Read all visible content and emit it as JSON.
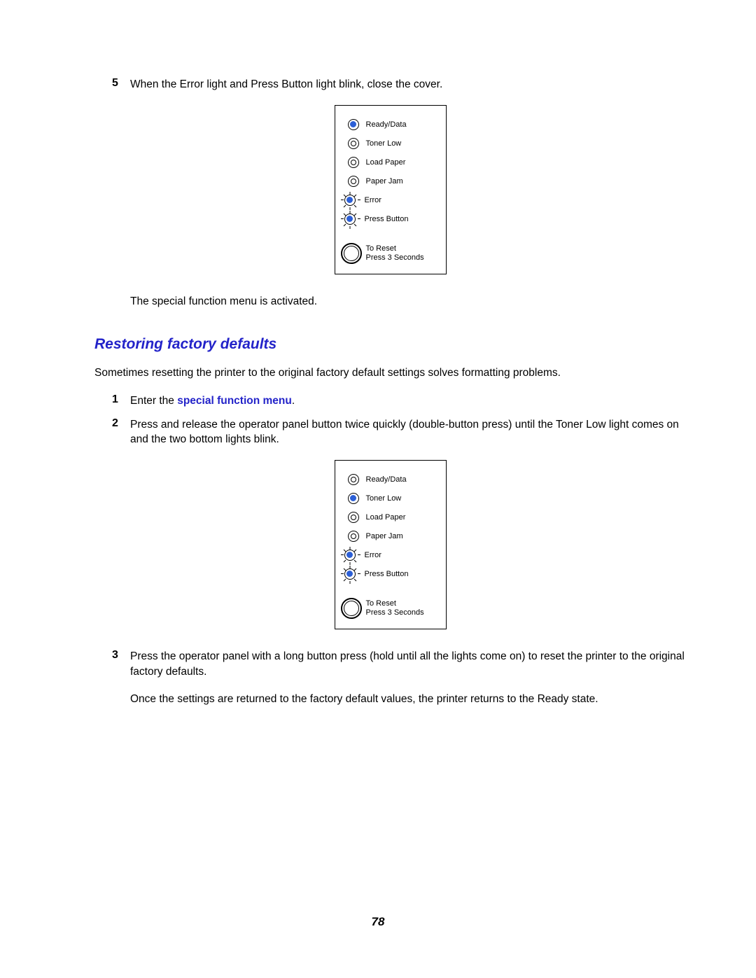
{
  "page_number": "78",
  "step5": {
    "num": "5",
    "text": "When the Error light and Press Button light blink, close the cover."
  },
  "step5_followup": "The special function menu is activated.",
  "section_heading": "Restoring factory defaults",
  "section_intro": "Sometimes resetting the printer to the original factory default settings solves formatting problems.",
  "step1": {
    "num": "1",
    "prefix": "Enter the ",
    "link": "special function menu",
    "suffix": "."
  },
  "step2": {
    "num": "2",
    "text": "Press and release the operator panel button twice quickly (double-button press) until the Toner Low light comes on and the two bottom lights blink."
  },
  "step3": {
    "num": "3",
    "text": "Press the operator panel with a long button press (hold until all the lights come on) to reset the printer to the original factory defaults."
  },
  "step3_followup": "Once the settings are returned to the factory default values, the printer returns to the Ready state.",
  "panel_labels": {
    "ready": "Ready/Data",
    "toner": "Toner Low",
    "load": "Load Paper",
    "jam": "Paper Jam",
    "error": "Error",
    "press": "Press Button",
    "reset1": "To Reset",
    "reset2": "Press 3 Seconds"
  },
  "panel1_states": {
    "ready": "on",
    "toner": "inner-empty",
    "load": "inner-empty",
    "jam": "inner-empty",
    "error": "blink-on",
    "press": "blink-on"
  },
  "panel2_states": {
    "ready": "inner-empty",
    "toner": "on",
    "load": "inner-empty",
    "jam": "inner-empty",
    "error": "blink-on",
    "press": "blink-on"
  }
}
